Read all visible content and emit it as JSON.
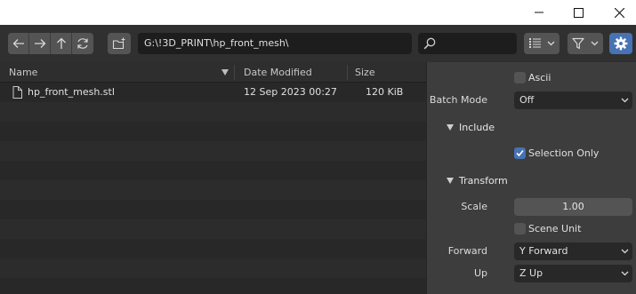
{
  "window": {
    "controls": [
      "minimize-icon",
      "maximize-icon",
      "close-icon"
    ]
  },
  "toolbar": {
    "nav_icons": [
      "back-arrow-icon",
      "forward-arrow-icon",
      "parent-directory-icon",
      "refresh-icon"
    ],
    "new_folder_icon": "new-folder-icon",
    "path_value": "G:\\!3D_PRINT\\hp_front_mesh\\",
    "search_value": "",
    "view_icon": "display-mode-icon",
    "filter_icon": "filter-icon",
    "settings_icon": "gear-icon",
    "accent_color": "#4772b3"
  },
  "filelist": {
    "columns": {
      "name": "Name",
      "date": "Date Modified",
      "size": "Size"
    },
    "files": [
      {
        "name": "hp_front_mesh.stl",
        "date": "12 Sep 2023 00:27",
        "size": "120 KiB",
        "icon": "file-icon"
      }
    ]
  },
  "options": {
    "ascii_label": "Ascii",
    "ascii_checked": false,
    "batch_mode_label": "Batch Mode",
    "batch_mode_value": "Off",
    "include_title": "Include",
    "selection_only_label": "Selection Only",
    "selection_only_checked": true,
    "transform_title": "Transform",
    "scale_label": "Scale",
    "scale_value": "1.00",
    "scene_unit_label": "Scene Unit",
    "scene_unit_checked": false,
    "forward_label": "Forward",
    "forward_value": "Y Forward",
    "up_label": "Up",
    "up_value": "Z Up"
  }
}
